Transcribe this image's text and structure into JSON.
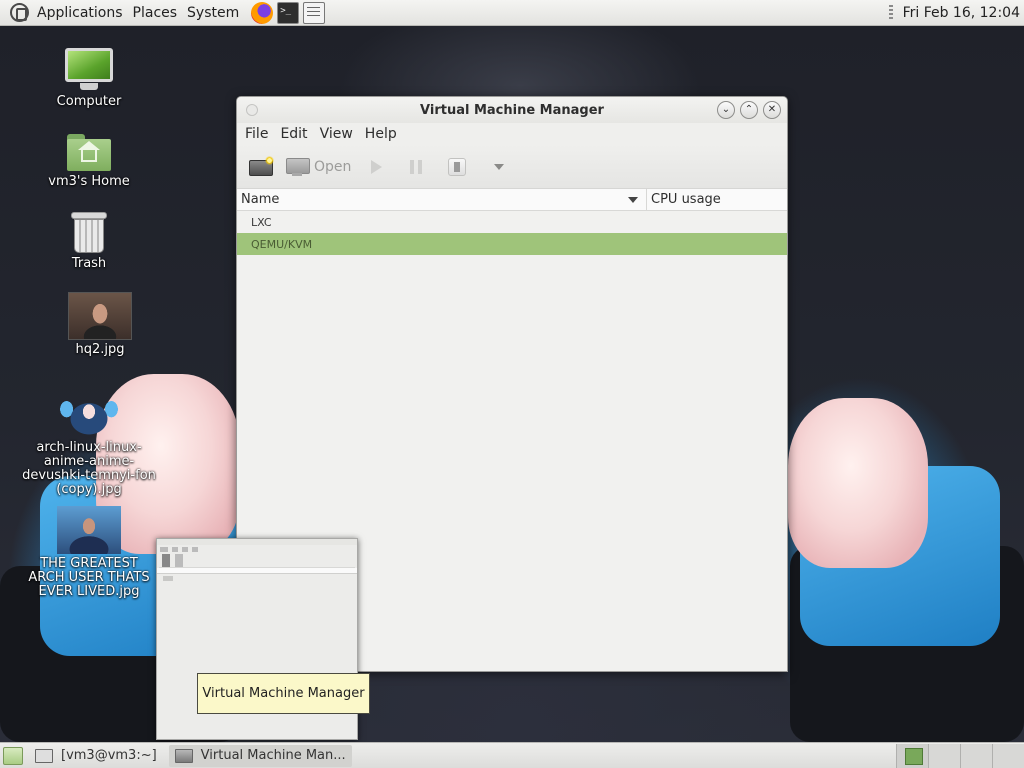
{
  "top_panel": {
    "menus": [
      "Applications",
      "Places",
      "System"
    ],
    "clock": "Fri Feb 16, 12:04"
  },
  "desktop": {
    "icons": [
      {
        "label": "Computer"
      },
      {
        "label": "vm3's Home"
      },
      {
        "label": "Trash"
      },
      {
        "label": "hq2.jpg"
      },
      {
        "label": "arch-linux-linux-anime-anime-devushki-temnyi-fon (copy).jpg"
      },
      {
        "label": "THE GREATEST ARCH USER THATS EVER LIVED.jpg"
      }
    ]
  },
  "window": {
    "title": "Virtual Machine Manager",
    "menu": [
      "File",
      "Edit",
      "View",
      "Help"
    ],
    "toolbar": {
      "open_label": "Open"
    },
    "columns": {
      "name": "Name",
      "cpu": "CPU usage"
    },
    "rows": [
      {
        "name": "LXC",
        "selected": false
      },
      {
        "name": "QEMU/KVM",
        "selected": true
      }
    ]
  },
  "tooltip": {
    "text": "Virtual Machine Manager"
  },
  "taskbar": {
    "tasks": [
      {
        "label": "[vm3@vm3:~]"
      },
      {
        "label": "Virtual Machine Man..."
      }
    ]
  },
  "colors": {
    "selected_row": "#9fc47a",
    "accent_green": "#79a85a",
    "tooltip_bg": "#fbf8c9"
  }
}
